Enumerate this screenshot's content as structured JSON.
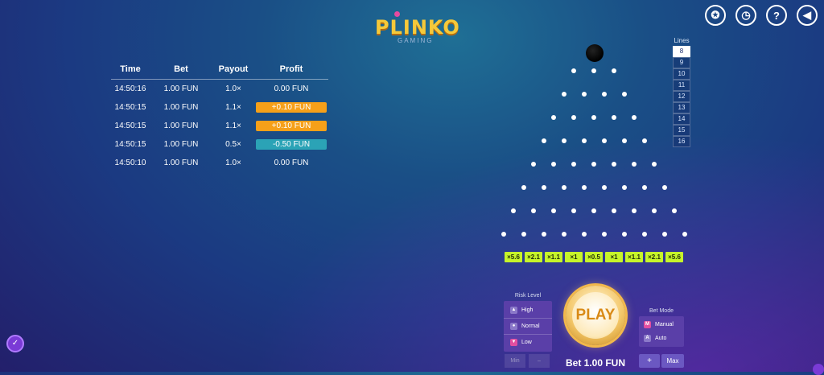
{
  "logo": {
    "title": "PLINKO",
    "subtitle": "GAMING"
  },
  "top_icons": [
    "medal-icon",
    "history-clock-icon",
    "help-icon",
    "sound-icon"
  ],
  "top_icon_glyphs": [
    "✪",
    "◷",
    "?",
    "◀"
  ],
  "history": {
    "headers": {
      "time": "Time",
      "bet": "Bet",
      "payout": "Payout",
      "profit": "Profit"
    },
    "rows": [
      {
        "time": "14:50:16",
        "bet": "1.00 FUN",
        "payout": "1.0×",
        "profit": "0.00 FUN",
        "kind": "none"
      },
      {
        "time": "14:50:15",
        "bet": "1.00 FUN",
        "payout": "1.1×",
        "profit": "+0.10 FUN",
        "kind": "pos"
      },
      {
        "time": "14:50:15",
        "bet": "1.00 FUN",
        "payout": "1.1×",
        "profit": "+0.10 FUN",
        "kind": "pos"
      },
      {
        "time": "14:50:15",
        "bet": "1.00 FUN",
        "payout": "0.5×",
        "profit": "-0.50 FUN",
        "kind": "neg"
      },
      {
        "time": "14:50:10",
        "bet": "1.00 FUN",
        "payout": "1.0×",
        "profit": "0.00 FUN",
        "kind": "none"
      }
    ]
  },
  "board": {
    "multipliers": [
      "×5.6",
      "×2.1",
      "×1.1",
      "×1",
      "×0.5",
      "×1",
      "×1.1",
      "×2.1",
      "×5.6"
    ],
    "slot_color": "#c6f42a"
  },
  "lines": {
    "title": "Lines",
    "options": [
      "8",
      "9",
      "10",
      "11",
      "12",
      "13",
      "14",
      "15",
      "16"
    ],
    "selected": "8"
  },
  "risk": {
    "title": "Risk Level",
    "options": [
      {
        "label": "High",
        "icon": "risk-high-icon",
        "active": false
      },
      {
        "label": "Normal",
        "icon": "risk-normal-icon",
        "active": false
      },
      {
        "label": "Low",
        "icon": "risk-low-icon",
        "active": true
      }
    ]
  },
  "bet_controls": {
    "min_label": "Min",
    "minus_label": "–",
    "plus_label": "+",
    "max_label": "Max"
  },
  "play": {
    "label": "PLAY",
    "bet_text": "Bet 1.00 FUN"
  },
  "mode": {
    "title": "Bet Mode",
    "options": [
      {
        "key": "M",
        "label": "Manual",
        "active": true
      },
      {
        "key": "A",
        "label": "Auto",
        "active": false
      }
    ]
  },
  "colors": {
    "profit_positive": "#f6a019",
    "profit_negative": "#2ba3b6",
    "accent": "#e24ea0"
  }
}
